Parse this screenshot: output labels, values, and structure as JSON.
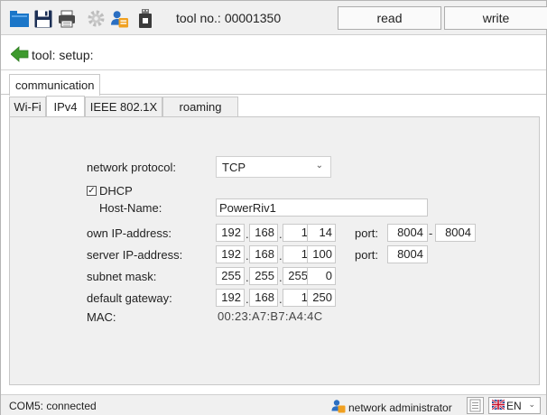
{
  "toolbar": {
    "tool_label": "tool no.:",
    "tool_number": "00001350",
    "read_label": "read",
    "write_label": "write",
    "icons": [
      "folder-open-icon",
      "save-icon",
      "printer-icon",
      "gear-icon",
      "user-icon",
      "usb-stick-icon"
    ]
  },
  "breadcrumb": {
    "text": "tool: setup:"
  },
  "tabs": {
    "outer": [
      {
        "label": "communication",
        "active": true
      }
    ],
    "inner": [
      {
        "label": "Wi-Fi",
        "active": false
      },
      {
        "label": "IPv4",
        "active": true
      },
      {
        "label": "IEEE 802.1X",
        "active": false
      },
      {
        "label": "roaming",
        "active": false
      }
    ]
  },
  "form": {
    "network_protocol_label": "network protocol:",
    "network_protocol_value": "TCP",
    "dhcp_label": "DHCP",
    "dhcp_checked": true,
    "hostname_label": "Host-Name:",
    "hostname_value": "PowerRiv1",
    "own_ip_label": "own IP-address:",
    "own_ip": [
      "192",
      "168",
      "1",
      "14"
    ],
    "server_ip_label": "server IP-address:",
    "server_ip": [
      "192",
      "168",
      "1",
      "100"
    ],
    "subnet_label": "subnet mask:",
    "subnet": [
      "255",
      "255",
      "255",
      "0"
    ],
    "gateway_label": "default gateway:",
    "gateway": [
      "192",
      "168",
      "1",
      "250"
    ],
    "mac_label": "MAC:",
    "mac_value": "00:23:A7:B7:A4:4C",
    "port_label": "port:",
    "own_port_from": "8004",
    "own_port_range_sep": "-",
    "own_port_to": "8004",
    "server_port": "8004"
  },
  "statusbar": {
    "connection": "COM5: connected",
    "role": "network administrator",
    "language": "EN"
  },
  "colors": {
    "accent_green": "#3e9a2e",
    "folder_blue": "#1b76c8",
    "toolbar_bg": "#f0f0f0"
  }
}
